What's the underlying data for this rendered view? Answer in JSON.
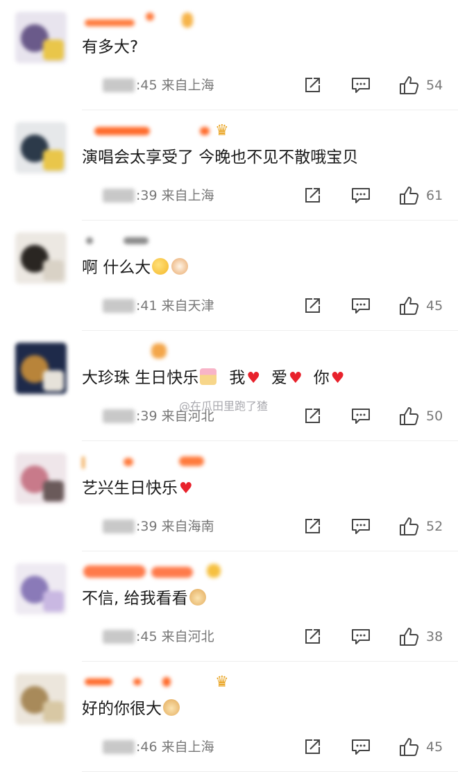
{
  "comments": [
    {
      "text": "有多大?",
      "time": ":45",
      "location": "来自上海",
      "likes": "54",
      "emojis": [],
      "name_color": "#ff7a3c",
      "badge": "",
      "avatar_colors": [
        "#e8e4ee",
        "#6a5a8a",
        "#e9c64a"
      ]
    },
    {
      "text": "演唱会太享受了 今晚也不见不散哦宝贝",
      "time": ":39",
      "location": "来自上海",
      "likes": "61",
      "emojis": [],
      "name_color": "#ff6a2a",
      "badge": "crown",
      "avatar_colors": [
        "#e6e8ea",
        "#2c3a4a",
        "#e9c64a"
      ]
    },
    {
      "text": "啊 什么大",
      "time": ":41",
      "location": "来自天津",
      "likes": "45",
      "emojis": [
        "thinking-face",
        "cat-face"
      ],
      "name_color": "#6a6a6a",
      "badge": "",
      "avatar_colors": [
        "#ece8e2",
        "#2a2622",
        "#d9d2c6"
      ]
    },
    {
      "text": "大珍珠 生日快乐",
      "text2": "我",
      "text3": "爱",
      "text4": "你",
      "time": ":39",
      "location": "来自河北",
      "likes": "50",
      "emojis": [
        "birthday-cake"
      ],
      "name_color": "#f3a64a",
      "badge": "",
      "avatar_colors": [
        "#1e2a4a",
        "#b8843a",
        "#e6e2da"
      ]
    },
    {
      "text": "艺兴生日快乐",
      "time": ":39",
      "location": "来自海南",
      "likes": "52",
      "emojis": [],
      "name_color": "#ff6a2a",
      "badge": "",
      "avatar_colors": [
        "#efe6ea",
        "#c87a8a",
        "#6a5a5a"
      ]
    },
    {
      "text": "不信, 给我看看",
      "time": ":45",
      "location": "来自河北",
      "likes": "38",
      "emojis": [
        "doge"
      ],
      "name_color": "#ff6a2a",
      "badge": "",
      "avatar_colors": [
        "#eeeaf2",
        "#8a7ab8",
        "#c9b8e2"
      ]
    },
    {
      "text": "好的你很大",
      "time": ":46",
      "location": "来自上海",
      "likes": "45",
      "emojis": [
        "doge"
      ],
      "name_color": "#ff6a2a",
      "badge": "crown-6",
      "avatar_colors": [
        "#ece6dc",
        "#a88a5a",
        "#d8c8a4"
      ]
    }
  ],
  "watermark": "@在瓜田里跑了猹",
  "icons": {
    "share": "share-icon",
    "comment": "comment-icon",
    "like": "thumbs-up-icon"
  },
  "colors": {
    "heart": "#e8222c",
    "meta": "#777777"
  }
}
